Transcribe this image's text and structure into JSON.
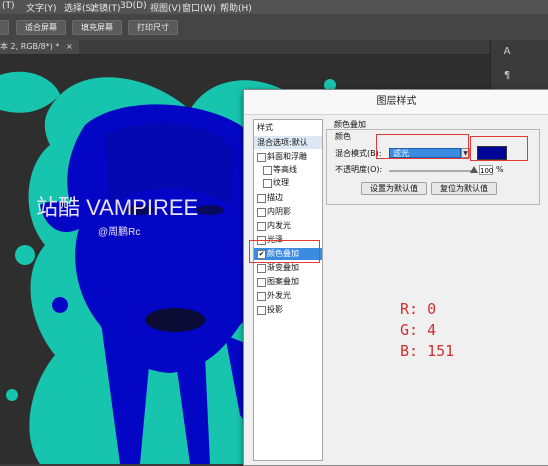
{
  "menubar": {
    "items": [
      "(T)",
      "文字(Y)",
      "选择(S)",
      "滤镜(T)",
      "3D(D)",
      "视图(V)",
      "窗口(W)",
      "帮助(H)"
    ]
  },
  "optionsbar": {
    "buttons": [
      "适合屏幕",
      "填充屏幕",
      "打印尺寸"
    ]
  },
  "document_tab": {
    "label": "本 2, RGB/8*) *",
    "close": "×"
  },
  "artwork": {
    "title": "站酷 VAMPIREE",
    "credit": "@周鹏Rc",
    "colors": {
      "paint": "#18c8b0",
      "overlay": "#0406c6",
      "shadow": "#0b0b36"
    }
  },
  "right_panel": {
    "icons": [
      "A",
      "¶",
      "A",
      "¶"
    ]
  },
  "dialog": {
    "title": "图层样式",
    "styles_header": "样式",
    "blend_options": "混合选项:默认",
    "style_items": [
      {
        "label": "斜面和浮雕",
        "checked": false,
        "indent": false
      },
      {
        "label": "等高线",
        "checked": false,
        "indent": true
      },
      {
        "label": "纹理",
        "checked": false,
        "indent": true
      },
      {
        "label": "描边",
        "checked": false,
        "indent": false
      },
      {
        "label": "内阴影",
        "checked": false,
        "indent": false
      },
      {
        "label": "内发光",
        "checked": false,
        "indent": false
      },
      {
        "label": "光泽",
        "checked": false,
        "indent": false
      },
      {
        "label": "颜色叠加",
        "checked": true,
        "indent": false,
        "selected": true
      },
      {
        "label": "渐变叠加",
        "checked": false,
        "indent": false
      },
      {
        "label": "图案叠加",
        "checked": false,
        "indent": false
      },
      {
        "label": "外发光",
        "checked": false,
        "indent": false
      },
      {
        "label": "投影",
        "checked": false,
        "indent": false
      }
    ],
    "color_overlay": {
      "group_title": "颜色叠加",
      "subgroup_title": "颜色",
      "blend_mode_label": "混合模式(B):",
      "blend_mode_value": "滤光",
      "overlay_color": "#000497",
      "opacity_label": "不透明度(O):",
      "opacity_value": "100",
      "opacity_unit": "%",
      "opacity_level": 1.0,
      "btn_set_default": "设置为默认值",
      "btn_reset_default": "复位为默认值"
    }
  },
  "annotation": {
    "r_label": "R:",
    "r_value": "0",
    "g_label": "G:",
    "g_value": "4",
    "b_label": "B:",
    "b_value": "151",
    "color": "#d42f2f"
  }
}
